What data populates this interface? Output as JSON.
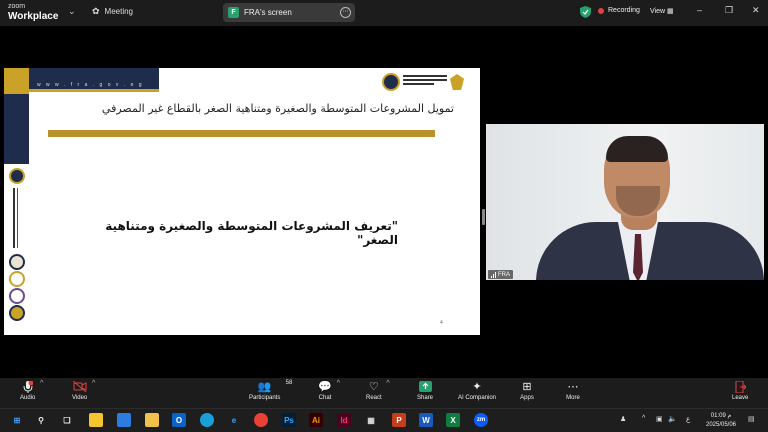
{
  "app": {
    "brand_top": "zoom",
    "brand_name": "Workplace",
    "meeting_label": "Meeting"
  },
  "share": {
    "badge": "F",
    "label": "FRA's screen"
  },
  "status": {
    "recording": "Recording",
    "view": "View",
    "record_color": "#e54040",
    "shield_color": "#2aa06e"
  },
  "slide": {
    "url": "w w w . f r a . g o v . e g",
    "title": "تمويل المشروعات المتوسطة والصغيرة ومتناهية الصغر بالقطاع غير المصرفي",
    "heading": "\"تعريف المشروعات المتوسطة والصغيرة ومتناهية الصغر\"",
    "page_number": "4",
    "colors": {
      "gold": "#b8932c",
      "navy": "#1f2c4c"
    }
  },
  "participant": {
    "name": "FRA"
  },
  "toolbar": {
    "audio": "Audio",
    "video": "Video",
    "participants": "Participants",
    "participants_count": "58",
    "chat": "Chat",
    "react": "React",
    "share": "Share",
    "ai_companion": "AI Companion",
    "apps": "Apps",
    "more": "More",
    "leave": "Leave"
  },
  "taskbar": {
    "time": "01:09 م",
    "date": "2025/05/06",
    "lang": "ع",
    "apps": [
      "Ps",
      "Ai",
      "Id",
      "P",
      "W",
      "X",
      "zm"
    ]
  }
}
